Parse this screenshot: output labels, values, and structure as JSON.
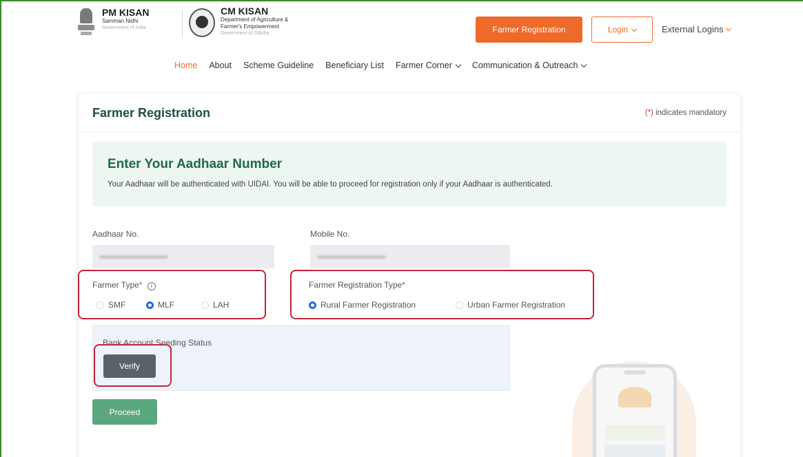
{
  "header": {
    "pm": {
      "title": "PM KISAN",
      "sub": "Samman Nidhi",
      "gov": "Government of India"
    },
    "cm": {
      "title": "CM KISAN",
      "sub1": "Department of Agriculture &",
      "sub2": "Farmer's Empowerment",
      "gov": "Government of Odisha"
    },
    "register_button": "Farmer Registration",
    "login_button": "Login",
    "external_logins": "External Logins",
    "accent": "#ee6a2b"
  },
  "nav": {
    "items": [
      "Home",
      "About",
      "Scheme Guideline",
      "Beneficiary List",
      "Farmer Corner",
      "Communication & Outreach"
    ]
  },
  "form": {
    "title": "Farmer Registration",
    "mandatory_star": "(*)",
    "mandatory_text": " indicates mandatory",
    "info_heading": "Enter Your Aadhaar Number",
    "info_text": "Your Aadhaar will be authenticated with UIDAI. You will be able to proceed for registration only if your Aadhaar is authenticated.",
    "aadhaar_label": "Aadhaar No.",
    "mobile_label": "Mobile No.",
    "farmer_type_label": "Farmer Type",
    "farmer_type_options": [
      "SMF",
      "MLF",
      "LAH"
    ],
    "farmer_type_selected": "MLF",
    "reg_type_label": "Farmer Registration Type",
    "reg_type_options": [
      "Rural Farmer Registration",
      "Urban Farmer Registration"
    ],
    "reg_type_selected": "Rural Farmer Registration",
    "bank_label": "Bank Account Seeding Status",
    "verify_button": "Verify",
    "proceed_button": "Proceed",
    "required_mark": "*",
    "info_glyph": "i"
  }
}
